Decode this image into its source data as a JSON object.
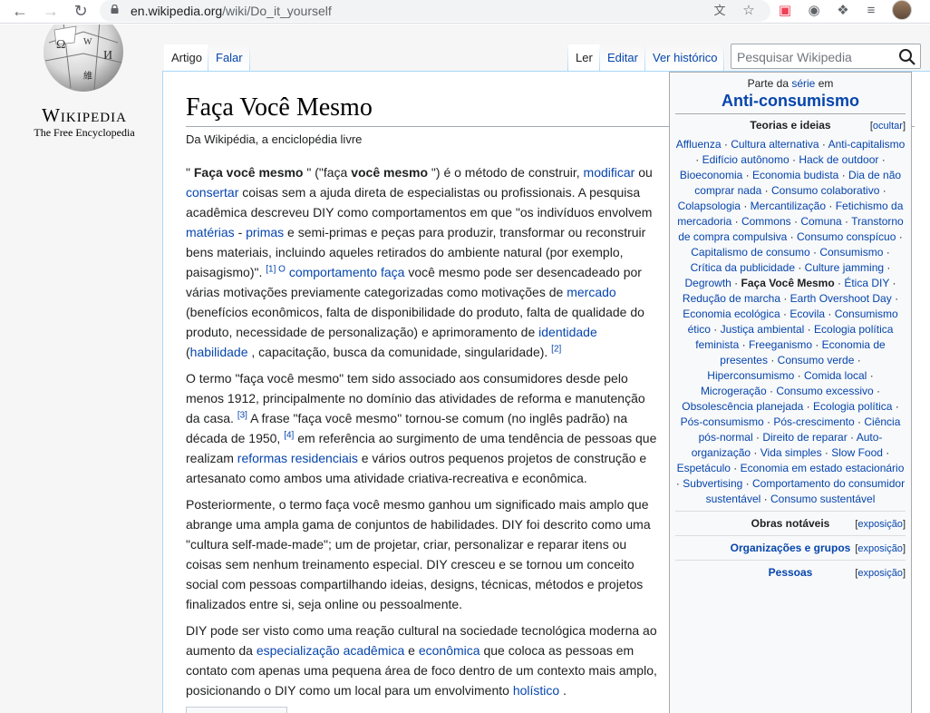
{
  "browser": {
    "url_host": "en.wikipedia.org",
    "url_path": "/wiki/Do_it_yourself"
  },
  "site": {
    "wordmark": "Wikipedia",
    "tagline": "The Free Encyclopedia"
  },
  "tabs": {
    "artigo": "Artigo",
    "falar": "Falar",
    "ler": "Ler",
    "editar": "Editar",
    "historico": "Ver histórico"
  },
  "search": {
    "placeholder": "Pesquisar Wikipedia"
  },
  "article": {
    "title": "Faça Você Mesmo",
    "subtitle": "Da Wikipédia, a enciclopédia livre",
    "p1": [
      {
        "t": "\" "
      },
      {
        "t": "Faça você mesmo",
        "b": true
      },
      {
        "t": " \" (\"faça "
      },
      {
        "t": "você mesmo",
        "b": true
      },
      {
        "t": " \") é o método de construir, "
      },
      {
        "t": "modificar",
        "l": true
      },
      {
        "t": " ou "
      },
      {
        "t": "consertar",
        "l": true
      },
      {
        "t": " coisas sem a ajuda direta de especialistas ou profissionais. A pesquisa acadêmica descreveu DIY como comportamentos em que \"os indivíduos envolvem "
      },
      {
        "t": "matérias",
        "l": true
      },
      {
        "t": " - "
      },
      {
        "t": "primas",
        "l": true
      },
      {
        "t": " e semi-primas e peças para produzir, transformar ou reconstruir bens materiais, incluindo aqueles retirados do ambiente natural (por exemplo, paisagismo)\". "
      },
      {
        "t": "[1] O",
        "sup": true
      },
      {
        "t": " "
      },
      {
        "t": "comportamento faça",
        "l": true
      },
      {
        "t": " você mesmo pode ser desencadeado por várias motivações previamente categorizadas como motivações de "
      },
      {
        "t": "mercado",
        "l": true
      },
      {
        "t": " (benefícios econômicos, falta de disponibilidade do produto, falta de qualidade do produto, necessidade de personalização) e aprimoramento de "
      },
      {
        "t": "identidade",
        "l": true
      },
      {
        "t": " ("
      },
      {
        "t": "habilidade",
        "l": true
      },
      {
        "t": " , capacitação, busca da comunidade, singularidade). "
      },
      {
        "t": "[2]",
        "sup": true
      }
    ],
    "p2": [
      {
        "t": "O termo \"faça você mesmo\" tem sido associado aos consumidores desde pelo menos 1912, principalmente no domínio das atividades de reforma e manutenção da casa. "
      },
      {
        "t": "[3]",
        "sup": true
      },
      {
        "t": " A frase \"faça você mesmo\" tornou-se comum (no inglês padrão) na década de 1950, "
      },
      {
        "t": "[4]",
        "sup": true
      },
      {
        "t": " em referência ao surgimento de uma tendência de pessoas que realizam "
      },
      {
        "t": "reformas residenciais",
        "l": true
      },
      {
        "t": " e vários outros pequenos projetos de construção e artesanato como ambos uma atividade criativa-recreativa e econômica."
      }
    ],
    "p3": [
      {
        "t": "Posteriormente, o termo faça você mesmo ganhou um significado mais amplo que abrange uma ampla gama de conjuntos de habilidades. DIY foi descrito como uma \"cultura self-made-made\"; um de projetar, criar, personalizar e reparar itens ou coisas sem nenhum treinamento especial. DIY cresceu e se tornou um conceito social com pessoas compartilhando ideias, designs, técnicas, métodos e projetos finalizados entre si, seja online ou pessoalmente."
      }
    ],
    "p4": [
      {
        "t": "DIY pode ser visto como uma reação cultural na sociedade tecnológica moderna ao aumento da "
      },
      {
        "t": "especialização acadêmica",
        "l": true
      },
      {
        "t": " e "
      },
      {
        "t": "econômica",
        "l": true
      },
      {
        "t": " que coloca as pessoas em contato com apenas uma pequena área de foco dentro de um contexto mais amplo, posicionando o DIY como um local para um envolvimento "
      },
      {
        "t": "holístico",
        "l": true
      },
      {
        "t": " ."
      }
    ]
  },
  "sidebar": {
    "series_prefix": "Parte da",
    "series_link": "série",
    "series_suffix": "em",
    "title": "Anti-consumismo",
    "theories_heading": "Teorias e ideias",
    "hide_label": "ocultar",
    "theories": [
      "Affluenza",
      "Cultura alternativa",
      "Anti-capitalismo",
      "Edifício autônomo",
      "Hack de outdoor",
      "Bioeconomia",
      "Economia budista",
      "Dia de não comprar nada",
      "Consumo colaborativo",
      "Colapsologia",
      "Mercantilização",
      "Fetichismo da mercadoria",
      "Commons",
      "Comuna",
      "Transtorno de compra compulsiva",
      "Consumo conspícuo",
      "Capitalismo de consumo",
      "Consumismo",
      "Crítica da publicidade",
      "Culture jamming",
      "Degrowth",
      "Faça Você Mesmo",
      "Ética DIY",
      "Redução de marcha",
      "Earth Overshoot Day",
      "Economia ecológica",
      "Ecovila",
      "Consumismo ético",
      "Justiça ambiental",
      "Ecologia política feminista",
      "Freeganismo",
      "Economia de presentes",
      "Consumo verde",
      "Hiperconsumismo",
      "Comida local",
      "Microgeração",
      "Consumo excessivo",
      "Obsolescência planejada",
      "Ecologia política",
      "Pós-consumismo",
      "Pós-crescimento",
      "Ciência pós-normal",
      "Direito de reparar",
      "Auto-organização",
      "Vida simples",
      "Slow Food",
      "Espetáculo",
      "Economia em estado estacionário",
      "Subvertising",
      "Comportamento do consumidor sustentável",
      "Consumo sustentável"
    ],
    "current_item": "Faça Você Mesmo",
    "sections": [
      {
        "label": "Obras notáveis",
        "toggle": "exposição",
        "blue": false
      },
      {
        "label": "Organizações e grupos",
        "toggle": "exposição",
        "blue": true
      },
      {
        "label": "Pessoas",
        "toggle": "exposição",
        "blue": true
      }
    ]
  }
}
